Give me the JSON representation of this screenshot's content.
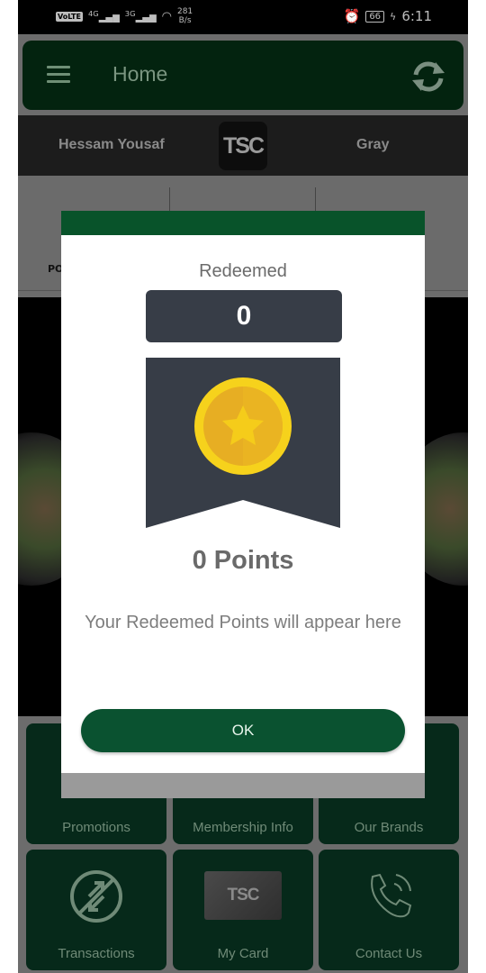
{
  "status_bar": {
    "network_badge": "VoLTE",
    "signal_1": "4G",
    "signal_2": "3G",
    "speed_value": "281",
    "speed_unit": "B/s",
    "battery": "66",
    "time": "6:11"
  },
  "app_bar": {
    "title": "Home"
  },
  "profile": {
    "name": "Hessam Yousaf",
    "logo_text": "TSC",
    "tier": "Gray"
  },
  "stats": {
    "first_label_partial": "PO"
  },
  "menu_tiles": [
    {
      "label": "Promotions",
      "icon": "promotions-icon"
    },
    {
      "label": "Membership Info",
      "icon": "membership-icon"
    },
    {
      "label": "Our Brands",
      "icon": "brands-icon"
    },
    {
      "label": "Transactions",
      "icon": "transactions-icon"
    },
    {
      "label": "My Card",
      "icon": "card-icon",
      "card_text": "TSC"
    },
    {
      "label": "Contact Us",
      "icon": "phone-icon"
    }
  ],
  "dialog": {
    "title": "Redeemed",
    "count": "0",
    "points_label": "0 Points",
    "message": "Your Redeemed Points will appear here",
    "ok_label": "OK"
  },
  "colors": {
    "primary_green": "#08532a",
    "appbar_green_dimmed": "#03230f",
    "count_box": "#373d47",
    "coin_gold": "#f5cc1a"
  }
}
